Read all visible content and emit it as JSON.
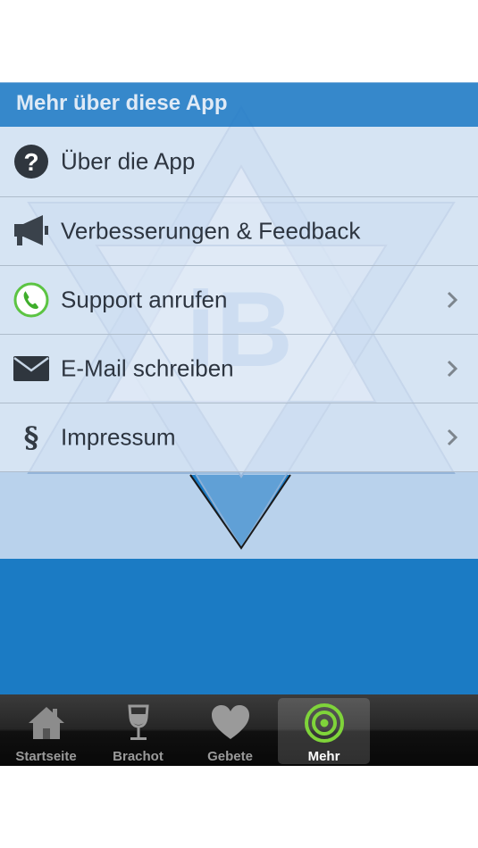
{
  "section": {
    "title": "Mehr über diese App"
  },
  "menu": [
    {
      "label": "Über die App",
      "icon": "question-icon",
      "chevron": false
    },
    {
      "label": "Verbesserungen & Feedback",
      "icon": "megaphone-icon",
      "chevron": false
    },
    {
      "label": "Support anrufen",
      "icon": "phone-icon",
      "chevron": true
    },
    {
      "label": "E-Mail schreiben",
      "icon": "envelope-icon",
      "chevron": true
    },
    {
      "label": "Impressum",
      "icon": "paragraph-icon",
      "glyph": "§",
      "chevron": true
    }
  ],
  "watermark": {
    "text": "iB"
  },
  "tabs": [
    {
      "label": "Startseite",
      "icon": "home-icon",
      "active": false
    },
    {
      "label": "Brachot",
      "icon": "wine-glass-icon",
      "active": false
    },
    {
      "label": "Gebete",
      "icon": "heart-icon",
      "active": false
    },
    {
      "label": "Mehr",
      "icon": "target-icon",
      "active": true
    }
  ],
  "colors": {
    "accent": "#1b7bc4",
    "header": "#2880c8",
    "panel": "#b9d2ec",
    "star": "#8fb6e0",
    "active_icon": "#7fd43a"
  }
}
